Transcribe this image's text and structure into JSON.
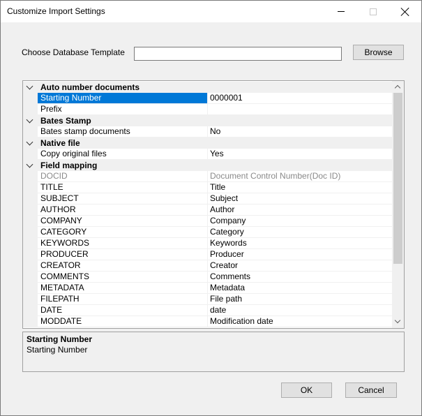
{
  "window": {
    "title": "Customize Import Settings"
  },
  "template": {
    "label": "Choose Database Template",
    "value": "",
    "browse_label": "Browse"
  },
  "grid": {
    "categories": [
      {
        "label": "Auto number documents",
        "rows": [
          {
            "name": "Starting Number",
            "value": "0000001",
            "selected": true
          },
          {
            "name": "Prefix",
            "value": ""
          }
        ]
      },
      {
        "label": "Bates Stamp",
        "rows": [
          {
            "name": "Bates stamp documents",
            "value": "No"
          }
        ]
      },
      {
        "label": "Native file",
        "rows": [
          {
            "name": "Copy original files",
            "value": "Yes"
          }
        ]
      },
      {
        "label": "Field mapping",
        "rows": [
          {
            "name": "DOCID",
            "value": "Document Control Number(Doc ID)",
            "disabled": true
          },
          {
            "name": "TITLE",
            "value": "Title"
          },
          {
            "name": "SUBJECT",
            "value": "Subject"
          },
          {
            "name": "AUTHOR",
            "value": "Author"
          },
          {
            "name": "COMPANY",
            "value": "Company"
          },
          {
            "name": "CATEGORY",
            "value": "Category"
          },
          {
            "name": "KEYWORDS",
            "value": "Keywords"
          },
          {
            "name": "PRODUCER",
            "value": "Producer"
          },
          {
            "name": "CREATOR",
            "value": "Creator"
          },
          {
            "name": "COMMENTS",
            "value": "Comments"
          },
          {
            "name": "METADATA",
            "value": "Metadata"
          },
          {
            "name": "FILEPATH",
            "value": "File path"
          },
          {
            "name": "DATE",
            "value": "date"
          },
          {
            "name": "MODDATE",
            "value": "Modification date"
          }
        ]
      }
    ]
  },
  "help": {
    "title": "Starting Number",
    "description": "Starting Number"
  },
  "buttons": {
    "ok_label": "OK",
    "cancel_label": "Cancel"
  },
  "colors": {
    "selection": "#0078d7",
    "category_background": "#f0f0f0"
  }
}
